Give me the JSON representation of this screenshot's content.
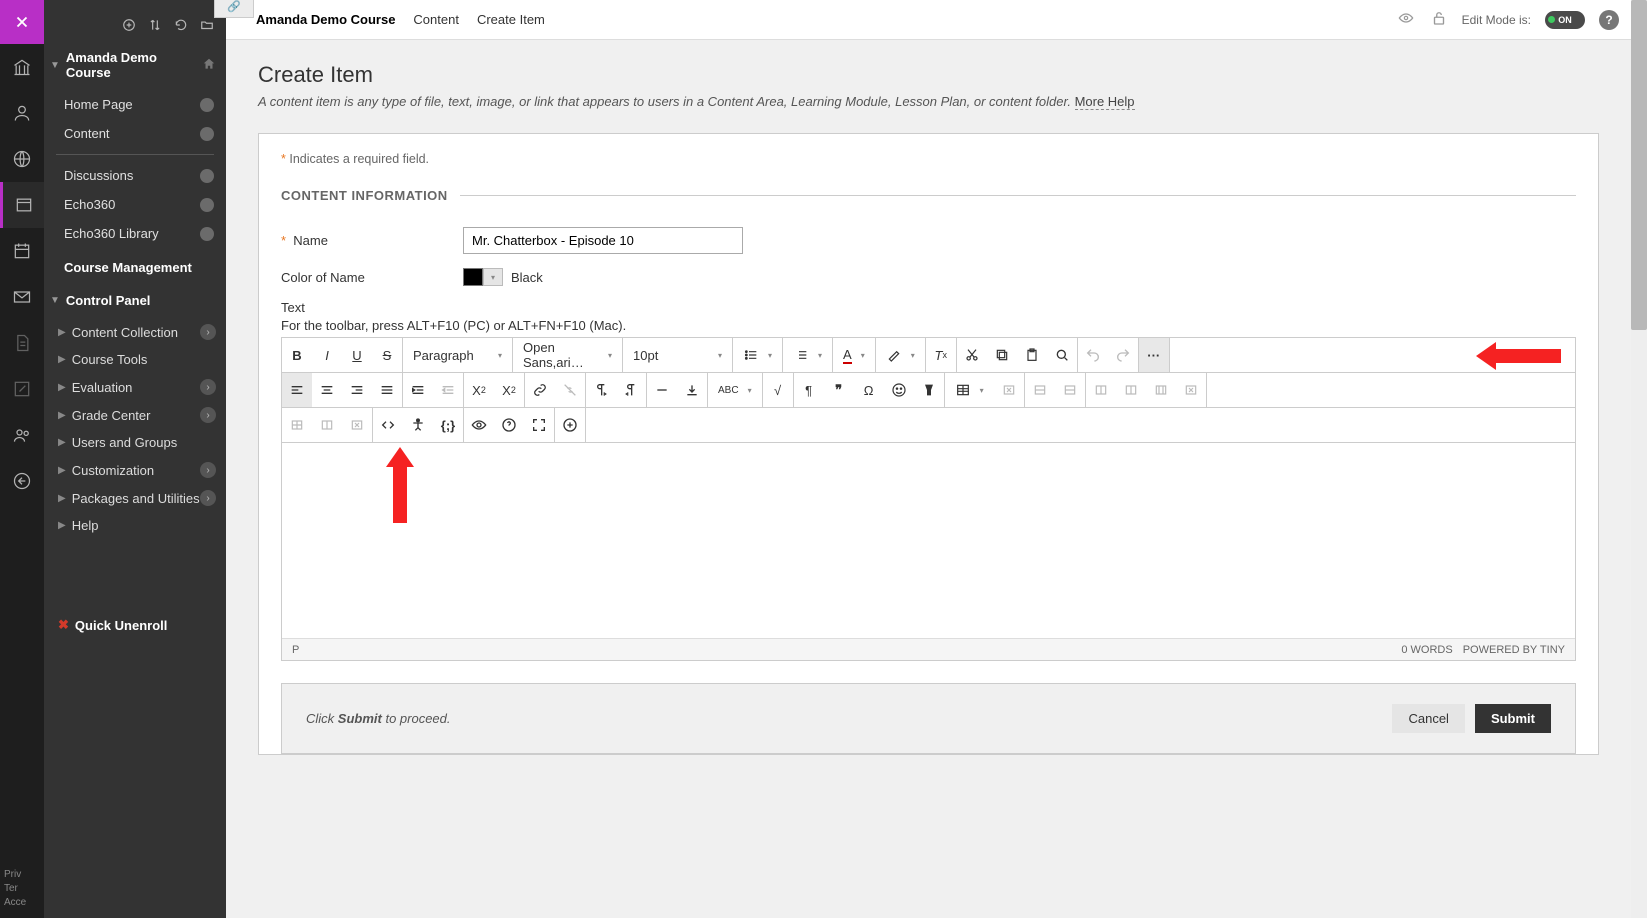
{
  "breadcrumbs": {
    "course": "Amanda Demo Course",
    "section": "Content",
    "page": "Create Item"
  },
  "top_right": {
    "edit_label": "Edit Mode is:",
    "toggle": "ON"
  },
  "sidebar": {
    "course_title": "Amanda Demo Course",
    "items": [
      "Home Page",
      "Content",
      "Discussions",
      "Echo360",
      "Echo360 Library"
    ],
    "mgmt_title": "Course Management",
    "cp_title": "Control Panel",
    "cp_items": [
      "Content Collection",
      "Course Tools",
      "Evaluation",
      "Grade Center",
      "Users and Groups",
      "Customization",
      "Packages and Utilities",
      "Help"
    ],
    "unenroll": "Quick Unenroll"
  },
  "footer_lines": [
    "Priv",
    "Ter",
    "Acce"
  ],
  "page": {
    "title": "Create Item",
    "desc": "A content item is any type of file, text, image, or link that appears to users in a Content Area, Learning Module, Lesson Plan, or content folder. ",
    "more": "More Help",
    "required_note": "Indicates a required field.",
    "section": "CONTENT INFORMATION",
    "name_label": "Name",
    "name_value": "Mr. Chatterbox - Episode 10",
    "color_label": "Color of Name",
    "color_name": "Black",
    "text_label": "Text",
    "text_hint": "For the toolbar, press ALT+F10 (PC) or ALT+FN+F10 (Mac)."
  },
  "editor": {
    "dd_format": "Paragraph",
    "dd_font": "Open Sans,ari…",
    "dd_size": "10pt",
    "footer_path": "P",
    "footer_words": "0 WORDS",
    "footer_power": "POWERED BY TINY"
  },
  "submit": {
    "hint_prefix": "Click ",
    "hint_bold": "Submit",
    "hint_suffix": " to proceed.",
    "cancel": "Cancel",
    "submit": "Submit"
  }
}
